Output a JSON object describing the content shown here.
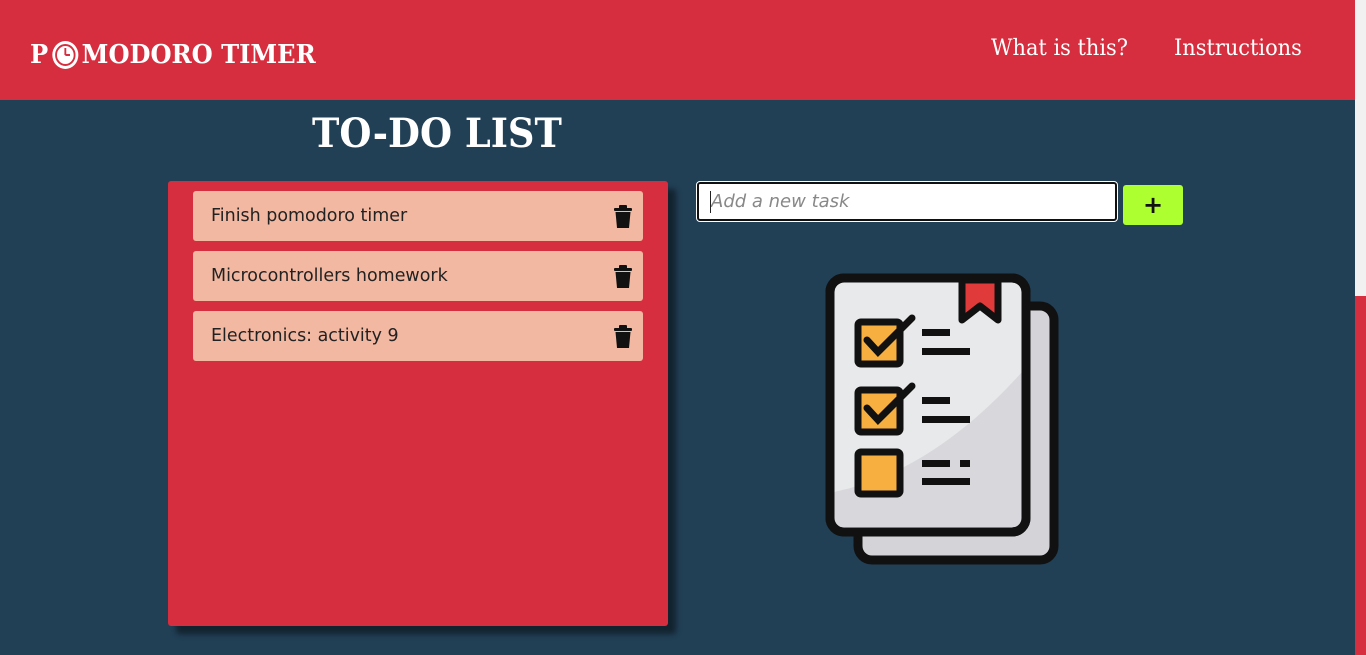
{
  "navbar": {
    "brand_prefix": "P",
    "brand_suffix": "MODORO TIMER",
    "links": [
      {
        "label": "What is this?"
      },
      {
        "label": "Instructions"
      }
    ],
    "color": "#d62e3e"
  },
  "main": {
    "title": "TO-DO LIST",
    "tasks": [
      {
        "text": "Finish pomodoro timer",
        "icon": "trash-icon"
      },
      {
        "text": "Microcontrollers homework",
        "icon": "trash-icon"
      },
      {
        "text": "Electronics: activity 9",
        "icon": "trash-icon"
      }
    ],
    "new_task": {
      "placeholder": "Add a new task",
      "value": "",
      "add_label": "+"
    },
    "illustration": "checklist-clipboard-icon"
  },
  "colors": {
    "background": "#213f55",
    "accent": "#d62e3e",
    "task_bg": "#f2b8a2",
    "add_button": "#adff2f"
  }
}
